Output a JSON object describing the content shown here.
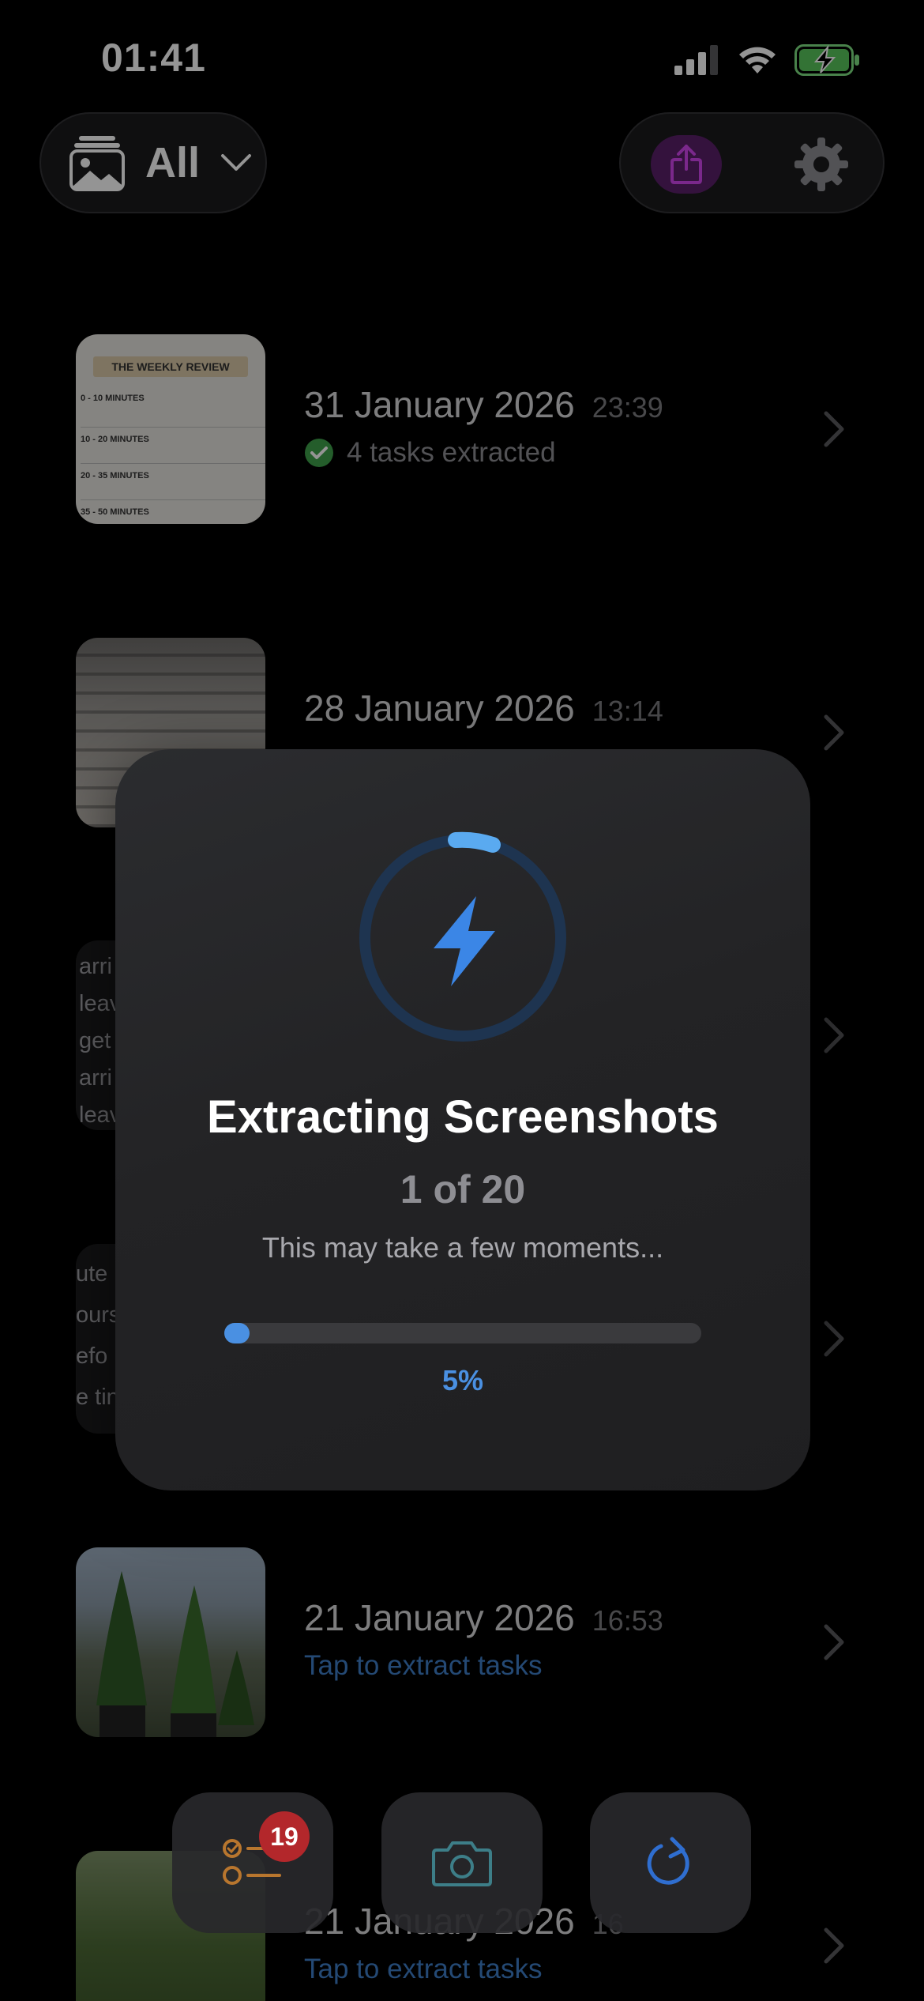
{
  "status_bar": {
    "time": "01:41"
  },
  "header": {
    "album_label": "All",
    "icons": [
      "photo-album-icon",
      "chevron-down-icon",
      "share-icon",
      "gear-icon"
    ],
    "share_accent": "#d246f0"
  },
  "rows": [
    {
      "date": "31 January 2026",
      "time": "23:39",
      "status": "4 tasks extracted",
      "status_kind": "done",
      "thumb_title": "THE WEEKLY REVIEW",
      "thumb_lines": [
        "0 - 10 MINUTES",
        "10 - 20 MINUTES",
        "20 - 35 MINUTES",
        "35 - 50 MINUTES"
      ]
    },
    {
      "date": "28 January 2026",
      "time": "13:14",
      "status": "",
      "status_kind": "none"
    },
    {
      "date": "",
      "time": "",
      "status": "",
      "status_kind": "none",
      "thumb_words": [
        "arri",
        "leav",
        "get",
        "arri",
        "leav"
      ]
    },
    {
      "date": "",
      "time": "",
      "status": "",
      "status_kind": "none",
      "thumb_words": [
        "ute",
        "ours",
        "efo",
        "e tin"
      ]
    },
    {
      "date": "21 January 2026",
      "time": "16:53",
      "status": "Tap to extract tasks",
      "status_kind": "tap"
    },
    {
      "date": "21 January 2026",
      "time": "16",
      "status": "Tap to extract tasks",
      "status_kind": "tap"
    }
  ],
  "modal": {
    "title": "Extracting Screenshots",
    "count": "1 of 20",
    "subtitle": "This may take a few moments...",
    "progress": 0.05,
    "progress_label": "5%",
    "icon": "lightning-bolt-icon",
    "accent": "#4a90e2"
  },
  "toolbar": {
    "tasks_badge": "19",
    "icons": [
      "task-list-icon",
      "camera-icon",
      "refresh-icon"
    ]
  }
}
